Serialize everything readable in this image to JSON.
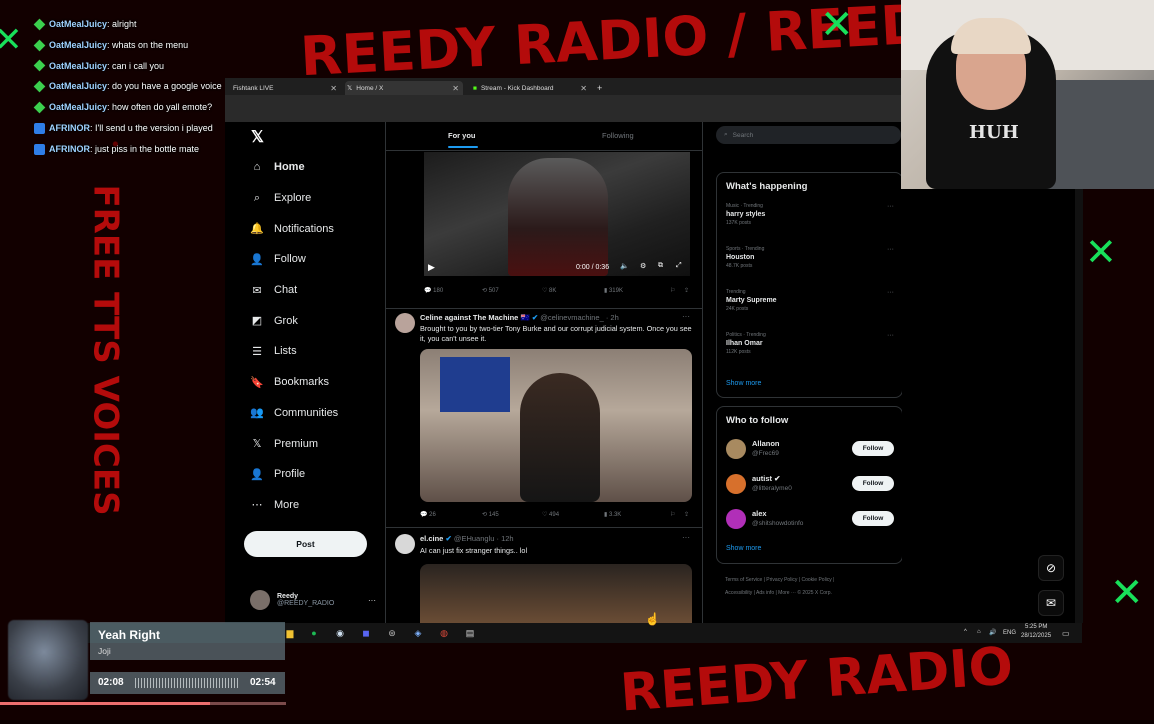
{
  "chat": [
    {
      "user": "OatMealJuicy",
      "msg": ": alright",
      "badge": "green"
    },
    {
      "user": "OatMealJuicy",
      "msg": ": whats on the menu",
      "badge": "green"
    },
    {
      "user": "OatMealJuicy",
      "msg": ": can i call you",
      "badge": "green"
    },
    {
      "user": "OatMealJuicy",
      "msg": ": do you have a google voice",
      "badge": "green"
    },
    {
      "user": "OatMealJuicy",
      "msg": ": how often do yall emote?",
      "badge": "green"
    },
    {
      "user": "AFRINOR",
      "msg": ": I'll send u the version i played",
      "badge": "blue"
    },
    {
      "user": "AFRINOR",
      "msg": ": just piss in the bottle mate",
      "badge": "blue"
    }
  ],
  "browser": {
    "tabs": [
      {
        "label": "Fishtank LIVE"
      },
      {
        "label": "Home / X"
      },
      {
        "label": "Stream - Kick Dashboard"
      }
    ],
    "new_tab": "+"
  },
  "sidebar": {
    "logo": "𝕏",
    "items": [
      {
        "label": "Home",
        "icon": "⌂"
      },
      {
        "label": "Explore",
        "icon": "⌕"
      },
      {
        "label": "Notifications",
        "icon": "🔔"
      },
      {
        "label": "Follow",
        "icon": "👤"
      },
      {
        "label": "Chat",
        "icon": "✉"
      },
      {
        "label": "Grok",
        "icon": "◩"
      },
      {
        "label": "Lists",
        "icon": "☰"
      },
      {
        "label": "Bookmarks",
        "icon": "🔖"
      },
      {
        "label": "Communities",
        "icon": "👥"
      },
      {
        "label": "Premium",
        "icon": "𝕏"
      },
      {
        "label": "Profile",
        "icon": "👤"
      },
      {
        "label": "More",
        "icon": "⋯"
      }
    ],
    "post_label": "Post",
    "profile": {
      "name": "Reedy",
      "handle": "@REEDY_RADIO"
    }
  },
  "feed": {
    "tabs": [
      "For you",
      "Following"
    ],
    "video": {
      "time": "0:00 / 0:36"
    },
    "video_actions": {
      "replies": "180",
      "reposts": "507",
      "likes": "8K",
      "views": "319K"
    },
    "tweet1": {
      "name": "Celine against The Machine 🇦🇺",
      "handle": "@celinevmachine_ · 2h",
      "text": "Brought to you by two-tier Tony Burke and our corrupt judicial system. Once you see it, you can't unsee it.",
      "actions": {
        "replies": "26",
        "reposts": "145",
        "likes": "494",
        "views": "3.3K"
      }
    },
    "tweet2": {
      "name": "el.cine",
      "handle": "@EHuanglu · 12h",
      "text": "AI can just fix stranger things.. lol"
    }
  },
  "right": {
    "search_placeholder": "Search",
    "happening_title": "What's happening",
    "trends": [
      {
        "cat": "Music · Trending",
        "name": "harry styles",
        "count": "137K posts"
      },
      {
        "cat": "Sports · Trending",
        "name": "Houston",
        "count": "48.7K posts"
      },
      {
        "cat": "Trending",
        "name": "Marty Supreme",
        "count": "24K posts"
      },
      {
        "cat": "Politics · Trending",
        "name": "Ilhan Omar",
        "count": "112K posts"
      }
    ],
    "show_more": "Show more",
    "wtf_title": "Who to follow",
    "follow": [
      {
        "name": "Allanon",
        "handle": "@Frec69",
        "button": "Follow"
      },
      {
        "name": "autist ✔",
        "handle": "@litteralyme0",
        "button": "Follow"
      },
      {
        "name": "alex",
        "handle": "@shitshowdotinfo",
        "button": "Follow"
      }
    ],
    "show_more2": "Show more",
    "footer": [
      "Terms of Service  |  Privacy Policy  |  Cookie Policy  |",
      "Accessibility  |  Ads info  |  More ···  © 2025 X Corp."
    ]
  },
  "taskbar": {
    "lang": "ENG",
    "time": "5:25 PM",
    "date": "28/12/2025"
  },
  "music": {
    "title": "Yeah Right",
    "artist": "Joji",
    "elapsed": "02:08",
    "duration": "02:54",
    "progress": 0.735
  },
  "overlay_text": {
    "top": "REEDY RADIO / REEDY",
    "left": "FREE TTS VOICES",
    "bottom": "REEDY RADIO"
  },
  "colors": {
    "x_blue": "#1d9bf0",
    "overlay_red": "#d10d0d",
    "overlay_green": "#18e05a"
  }
}
